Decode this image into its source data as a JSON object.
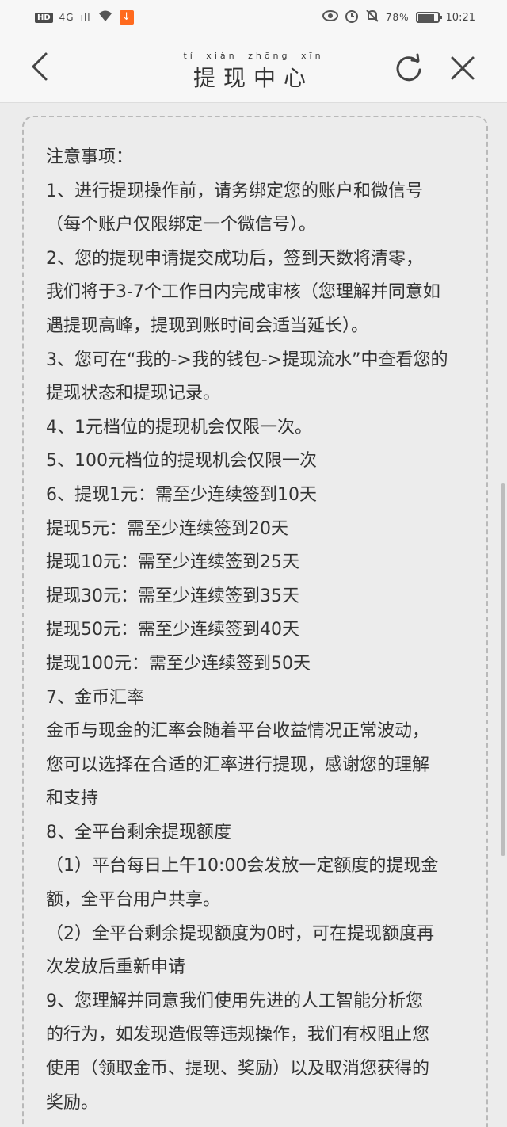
{
  "status_bar": {
    "hd": "HD",
    "network": "4G",
    "signal": "ıll",
    "battery_pct": "78%",
    "time": "10:21"
  },
  "nav": {
    "title": "提现中心",
    "pinyin": "tí xiàn zhōng xīn"
  },
  "notice": {
    "lines": [
      "注意事项：",
      "1、进行提现操作前，请务绑定您的账户和微信号",
      "（每个账户仅限绑定一个微信号）。",
      "2、您的提现申请提交成功后，签到天数将清零，",
      "我们将于3-7个工作日内完成审核（您理解并同意如",
      "遇提现高峰，提现到账时间会适当延长）。",
      "3、您可在“我的->我的钱包->提现流水”中查看您的",
      "提现状态和提现记录。",
      "4、1元档位的提现机会仅限一次。",
      "5、100元档位的提现机会仅限一次",
      "6、提现1元：需至少连续签到10天",
      "提现5元：需至少连续签到20天",
      "提现10元：需至少连续签到25天",
      "提现30元：需至少连续签到35天",
      "提现50元：需至少连续签到40天",
      "提现100元：需至少连续签到50天",
      "7、金币汇率",
      "金币与现金的汇率会随着平台收益情况正常波动，",
      "您可以选择在合适的汇率进行提现，感谢您的理解",
      "和支持",
      "8、全平台剩余提现额度",
      "（1）平台每日上午10:00会发放一定额度的提现金",
      "额，全平台用户共享。",
      "（2）全平台剩余提现额度为0时，可在提现额度再",
      "次发放后重新申请",
      "9、您理解并同意我们使用先进的人工智能分析您",
      "的行为，如发现造假等违规操作，我们有权阻止您",
      "使用（领取金币、提现、奖励）以及取消您获得的",
      "奖励。"
    ]
  }
}
